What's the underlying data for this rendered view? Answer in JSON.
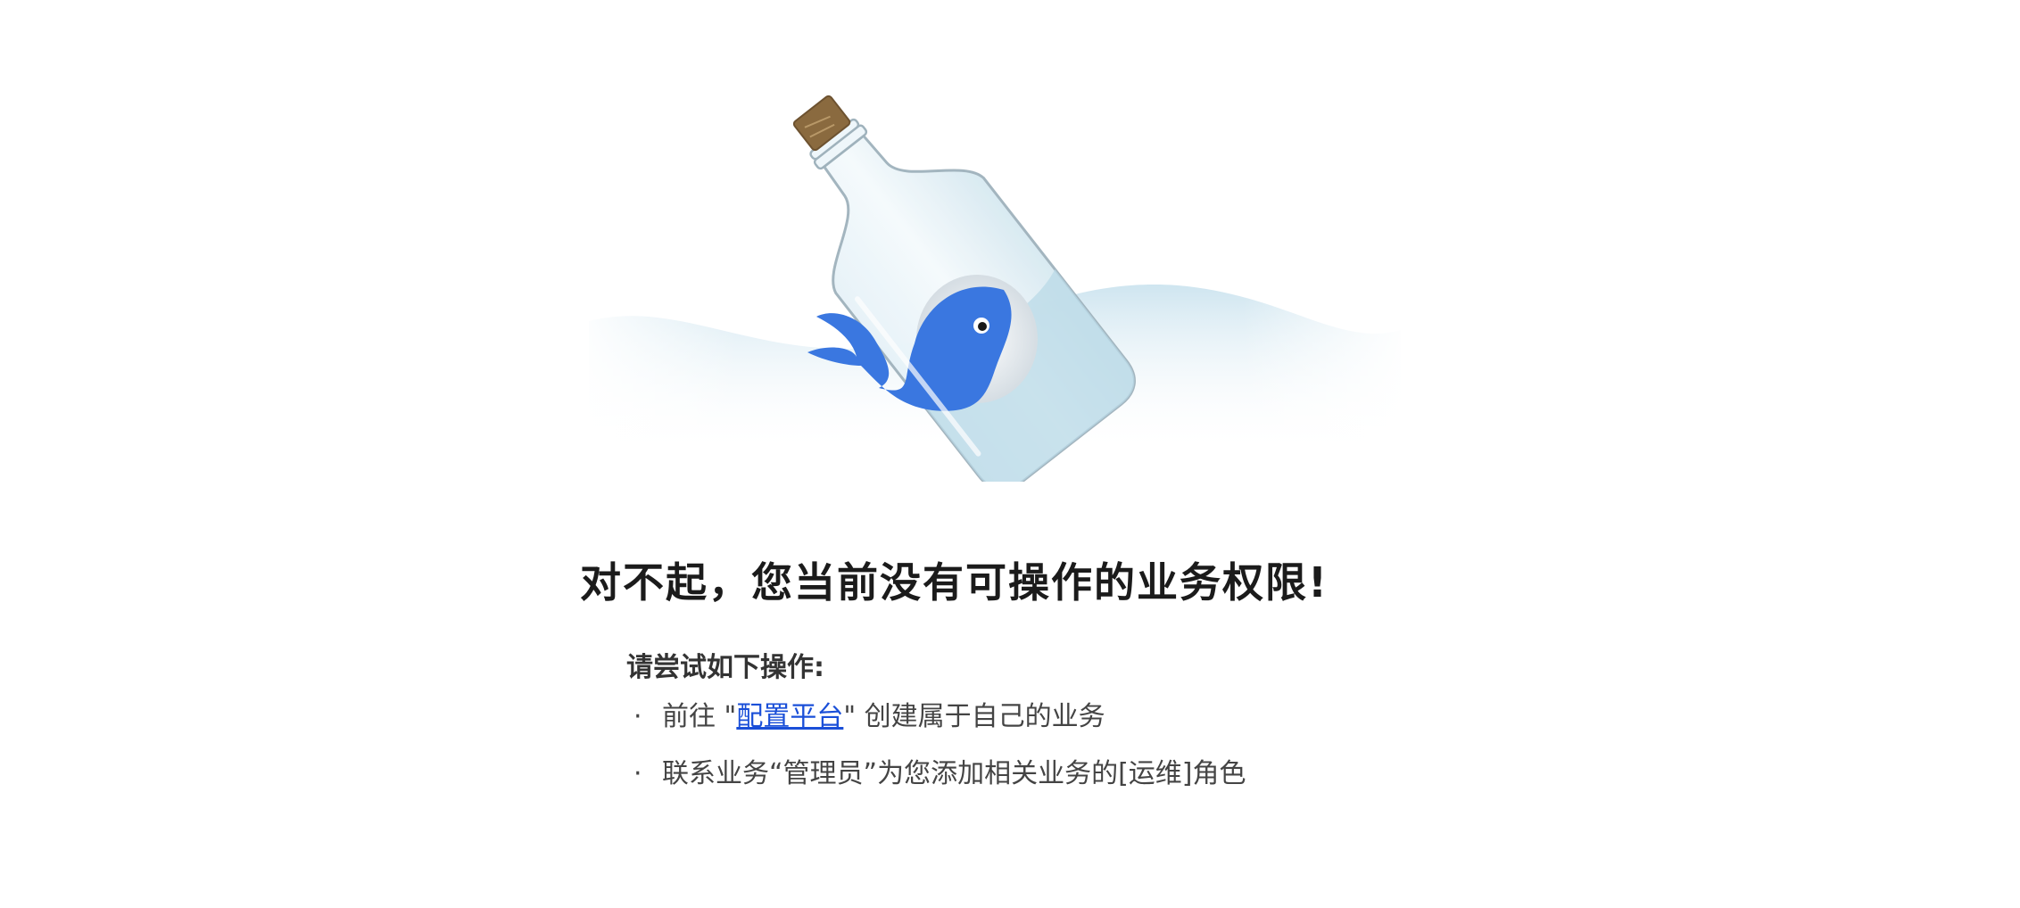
{
  "illustration": {
    "icon": "whale-in-bottle-icon",
    "colors": {
      "whale": "#3a77e0",
      "bottle": "#dceef6",
      "water": "#c9e2ee",
      "cork": "#8a6a3f"
    }
  },
  "message": {
    "title": "对不起，您当前没有可操作的业务权限!",
    "tips_heading": "请尝试如下操作:",
    "tips": [
      {
        "bullet": "·",
        "before": "前往 \"",
        "link": "配置平台",
        "after": "\" 创建属于自己的业务"
      },
      {
        "bullet": "·",
        "text": "联系业务“管理员”为您添加相关业务的[运维]角色"
      }
    ]
  }
}
